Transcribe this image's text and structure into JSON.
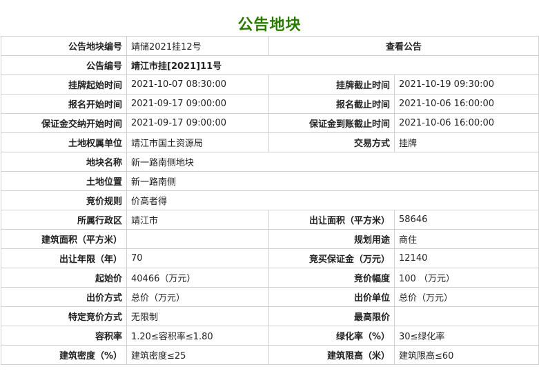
{
  "page": {
    "title": "公告地块"
  },
  "rows": {
    "r1": {
      "label": "公告地块编号",
      "value": "靖储2021挂12号",
      "link": "查看公告"
    },
    "r2": {
      "label": "公告编号",
      "value": "靖江市挂[2021]11号"
    },
    "r3": {
      "l1": "挂牌起始时间",
      "v1": "2021-10-07 08:30:00",
      "l2": "挂牌截止时间",
      "v2": "2021-10-19 09:30:00"
    },
    "r4": {
      "l1": "报名开始时间",
      "v1": "2021-09-17 09:00:00",
      "l2": "报名截止时间",
      "v2": "2021-10-06 16:00:00"
    },
    "r5": {
      "l1": "保证金交纳开始时间",
      "v1": "2021-09-17 09:00:00",
      "l2": "保证金到账截止时间",
      "v2": "2021-10-06 16:00:00"
    },
    "r6": {
      "l1": "土地权属单位",
      "v1": "靖江市国土资源局",
      "l2": "交易方式",
      "v2": "挂牌"
    },
    "r7": {
      "label": "地块名称",
      "value": "新一路南侧地块"
    },
    "r8": {
      "label": "土地位置",
      "value": "新一路南侧"
    },
    "r9": {
      "label": "竞价规则",
      "value": "价高者得"
    },
    "r10": {
      "l1": "所属行政区",
      "v1": "靖江市",
      "l2": "出让面积（平方米）",
      "v2": "58646"
    },
    "r11": {
      "l1": "建筑面积（平方米）",
      "v1": "",
      "l2": "规划用途",
      "v2": "商住"
    },
    "r12": {
      "l1": "出让年限（年）",
      "v1": "70",
      "l2": "竞买保证金（万元）",
      "v2": "12140"
    },
    "r13": {
      "l1": "起始价",
      "v1": "40466（万元）",
      "l2": "竞价幅度",
      "v2": "100 （万元）"
    },
    "r14": {
      "l1": "出价方式",
      "v1": "总价（万元）",
      "l2": "出价单位",
      "v2": "总价（万元）"
    },
    "r15": {
      "l1": "特定竞价方式",
      "v1": "无限制",
      "l2": "最高限价",
      "v2": ""
    },
    "r16": {
      "l1": "容积率",
      "v1": "1.20≤容积率≤1.80",
      "l2": "绿化率（%）",
      "v2": "30≤绿化率"
    },
    "r17": {
      "l1": "建筑密度（%）",
      "v1": "建筑密度≤25",
      "l2": "建筑限高（米）",
      "v2": "建筑限高≤60"
    }
  }
}
